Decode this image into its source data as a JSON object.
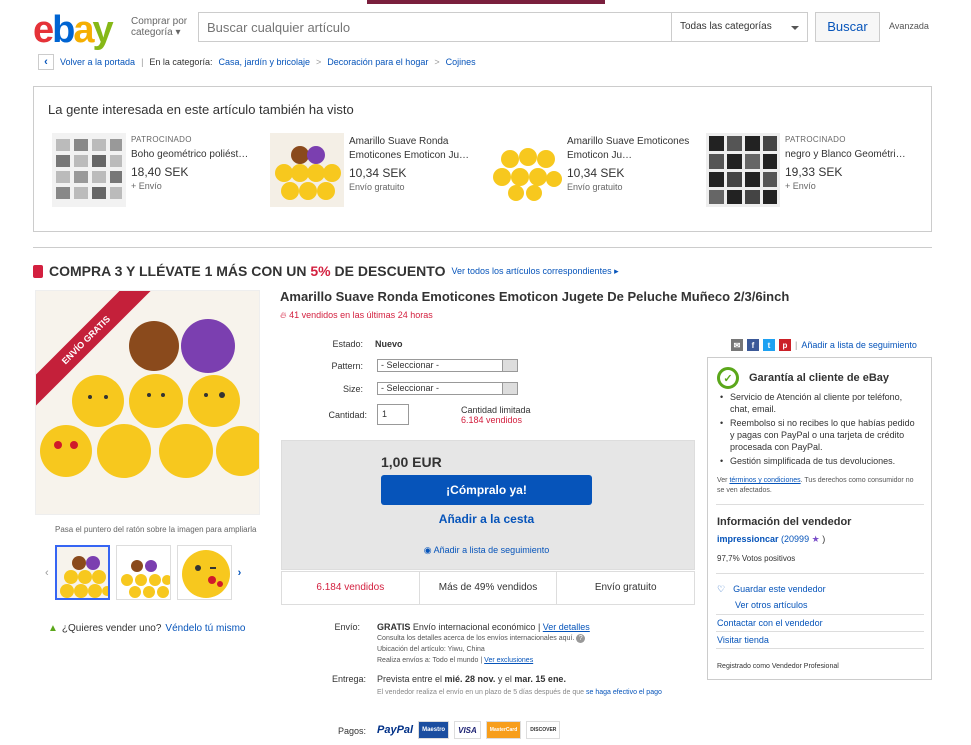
{
  "header": {
    "logo": [
      "e",
      "b",
      "a",
      "y"
    ],
    "shop_by": "Comprar por",
    "shop_by2": "categoría",
    "search_placeholder": "Buscar cualquier artículo",
    "category_select": "Todas las categorías",
    "search_button": "Buscar",
    "advanced": "Avanzada"
  },
  "breadcrumb": {
    "back": "Volver a la portada",
    "in_category": "En la categoría:",
    "items": [
      "Casa, jardín y bricolaje",
      "Decoración para el hogar",
      "Cojines"
    ]
  },
  "recommendations": {
    "title": "La gente interesada en este artículo también ha visto",
    "items": [
      {
        "sponsored": "PATROCINADO",
        "title": "Boho geométrico poliést…",
        "price": "18,40 SEK",
        "shipping": "+ Envío"
      },
      {
        "sponsored": "",
        "title": "Amarillo Suave Ronda Emoticones Emoticon Ju…",
        "price": "10,34 SEK",
        "shipping": "Envío gratuito"
      },
      {
        "sponsored": "",
        "title": "Amarillo Suave Emoticones Emoticon Ju…",
        "price": "10,34 SEK",
        "shipping": "Envío gratuito"
      },
      {
        "sponsored": "PATROCINADO",
        "title": "negro y Blanco Geométri…",
        "price": "19,33 SEK",
        "shipping": "+ Envío"
      }
    ]
  },
  "promo": {
    "text1": "COMPRA 3 Y LLÉVATE 1 MÁS CON UN ",
    "pct": "5%",
    "text2": " DE DESCUENTO",
    "see_all": "Ver todos los artículos correspondientes ▸"
  },
  "image": {
    "ribbon": "ENVÍO GRATIS",
    "hover_hint": "Pasa el puntero del ratón sobre la imagen para ampliarla"
  },
  "sell": {
    "question": "¿Quieres vender uno?",
    "link": "Véndelo tú mismo"
  },
  "item": {
    "title": "Amarillo Suave Ronda Emoticones Emoticon Jugete De Peluche Muñeco 2/3/6inch",
    "hot": "41 vendidos en las últimas 24 horas",
    "condition_label": "Estado:",
    "condition": "Nuevo",
    "pattern_label": "Pattern:",
    "pattern_value": "- Seleccionar -",
    "size_label": "Size:",
    "size_value": "- Seleccionar -",
    "qty_label": "Cantidad:",
    "qty": "1",
    "limited": "Cantidad limitada",
    "sold_count": "6.184 vendidos",
    "price": "1,00 EUR",
    "buy_now": "¡Cómpralo ya!",
    "add_cart": "Añadir a la cesta",
    "watch": "Añadir a lista de seguimiento",
    "stats": [
      "6.184 vendidos",
      "Más de 49% vendidos",
      "Envío gratuito"
    ]
  },
  "shipping": {
    "label": "Envío:",
    "free": "GRATIS",
    "method": "Envío internacional económico",
    "details": "Ver detalles",
    "note1": "Consulta los detalles acerca de los envíos internacionales aquí.",
    "location": "Ubicación del artículo:  Yiwu, China",
    "ships_to_label": "Realiza envíos a:",
    "ships_to": "Todo el mundo",
    "exclusions": "Ver exclusiones",
    "delivery_label": "Entrega:",
    "delivery_pre": "Prevista entre el ",
    "delivery_d1": "mié. 28 nov.",
    "delivery_mid": " y el ",
    "delivery_d2": "mar. 15 ene.",
    "delivery_note": "El vendedor realiza el envío en un plazo de 5 días después de que ",
    "delivery_link": "se haga efectivo el pago",
    "payments_label": "Pagos:",
    "pay_methods": [
      "PayPal",
      "Maestro",
      "VISA",
      "MasterCard",
      "DISCOVER"
    ]
  },
  "social": {
    "watchlist": "Añadir a lista de seguimiento"
  },
  "guarantee": {
    "title": "Garantía al cliente de eBay",
    "points": [
      "Servicio de Atención al cliente por teléfono, chat, email.",
      "Reembolso si no recibes lo que habías pedido y pagas con PayPal o una tarjeta de crédito procesada con PayPal.",
      "Gestión simplificada de tus devoluciones."
    ],
    "terms_pre": "Ver ",
    "terms_link": "términos y condiciones",
    "terms_post": ". Tus derechos como consumidor no se ven afectados."
  },
  "seller": {
    "title": "Información del vendedor",
    "name": "impressioncar",
    "feedback": "(20999",
    "feedback_end": ")",
    "positive": "97,7% Votos positivos",
    "save": "Guardar este vendedor",
    "other": "Ver otros artículos",
    "contact": "Contactar con el vendedor",
    "store": "Visitar tienda",
    "registered": "Registrado como Vendedor Profesional"
  }
}
